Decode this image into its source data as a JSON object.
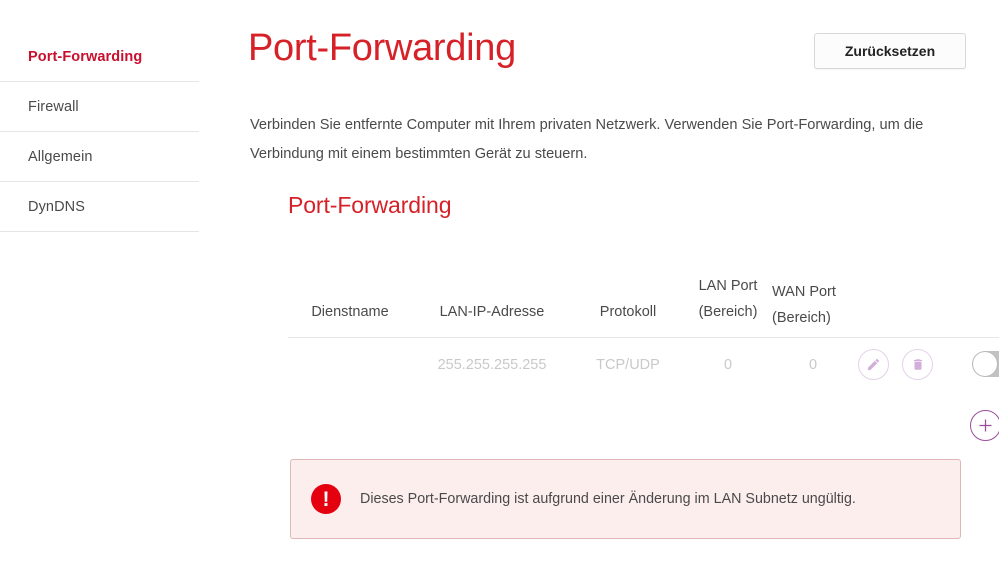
{
  "sidebar": {
    "items": [
      {
        "label": "Port-Forwarding",
        "active": true
      },
      {
        "label": "Firewall",
        "active": false
      },
      {
        "label": "Allgemein",
        "active": false
      },
      {
        "label": "DynDNS",
        "active": false
      }
    ]
  },
  "header": {
    "title": "Port-Forwarding",
    "reset_label": "Zurücksetzen"
  },
  "intro": {
    "text": "Verbinden Sie entfernte Computer mit Ihrem privaten Netzwerk. Verwenden Sie Port-Forwarding, um die Verbindung mit einem bestimmten Gerät zu steuern."
  },
  "section": {
    "title": "Port-Forwarding"
  },
  "table": {
    "columns": [
      "Dienstname",
      "LAN-IP-Adresse",
      "Protokoll",
      "LAN Port (Bereich)",
      "WAN Port (Bereich)"
    ],
    "rows": [
      {
        "dienstname": "",
        "lan_ip_adresse": "255.255.255.255",
        "protokoll": "TCP/UDP",
        "lan_port": "0",
        "wan_port": "0",
        "enabled": false
      }
    ]
  },
  "actions": {
    "edit_icon": "pencil-icon",
    "delete_icon": "trash-icon",
    "add_icon": "plus-icon",
    "toggle_state": "off"
  },
  "alert": {
    "icon": "error-exclamation-icon",
    "symbol": "!",
    "message": "Dieses Port-Forwarding ist aufgrund einer Änderung im LAN Subnetz ungültig."
  },
  "colors": {
    "brand_red": "#d62128",
    "active_nav_red": "#c8102e",
    "accent_purple": "#9b4d9b",
    "icon_purple_light": "#d4aedb",
    "disabled_text": "#c9c9c9",
    "alert_bg": "#fdeeee",
    "alert_border": "#e0b6b6",
    "alert_icon_red": "#e4000f",
    "toggle_off": "#c2c2c2"
  }
}
